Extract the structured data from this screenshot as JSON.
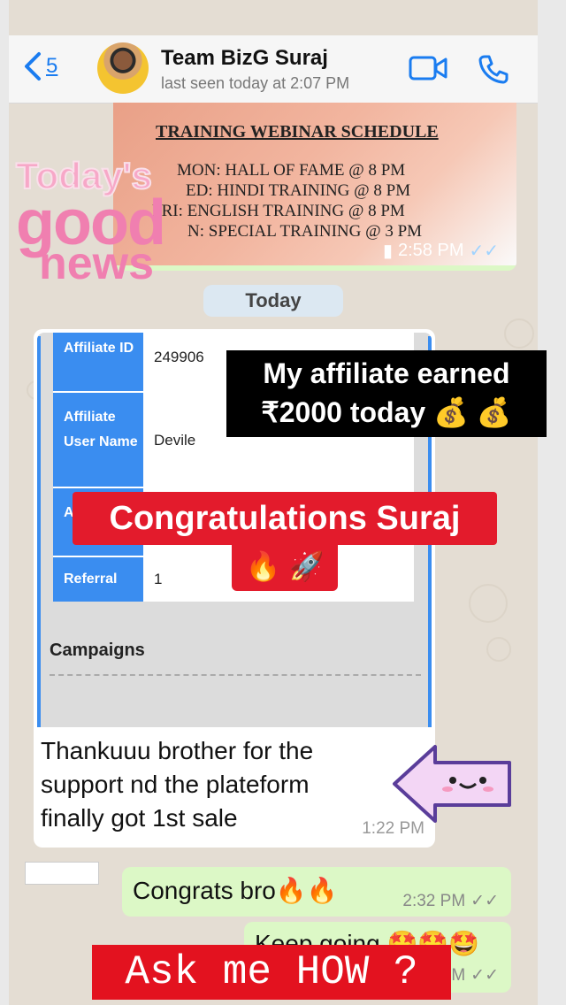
{
  "header": {
    "back_count": "5",
    "contact_name": "Team BizG Suraj",
    "last_seen": "last seen today at 2:07 PM"
  },
  "webinar_bubble": {
    "title": "TRAINING WEBINAR SCHEDULE",
    "lines": [
      "MON: HALL OF FAME @ 8 PM",
      "ED: HINDI TRAINING @ 8 PM",
      "FRI: ENGLISH TRAINING @ 8 PM",
      "N: SPECIAL TRAINING @ 3 PM"
    ],
    "time": "2:58 PM"
  },
  "sticker": {
    "line1": "Today's",
    "line2": "good",
    "line3": "news"
  },
  "date_divider": "Today",
  "incoming": {
    "table": [
      {
        "key": "Affiliate ID",
        "value": "249906"
      },
      {
        "key": "Affiliate User Name",
        "value": "Devile"
      },
      {
        "key": "A E",
        "value": ""
      },
      {
        "key": "Referral",
        "value": "1"
      }
    ],
    "campaigns_label": "Campaigns",
    "text": "Thankuuu brother for the support nd the plateform finally got 1st sale",
    "time": "1:22 PM"
  },
  "overlays": {
    "earned_line1": "My affiliate earned",
    "earned_line2": "₹2000 today 💰 💰",
    "congrats": "Congratulations Suraj",
    "fire_rocket": "🔥 🚀",
    "ask": "Ask me HOW ?"
  },
  "outgoing": [
    {
      "text": "Congrats bro🔥🔥",
      "time": "2:32 PM"
    },
    {
      "text": "Keep going 🤩🤩🤩",
      "time": "M"
    }
  ],
  "colors": {
    "accent_blue": "#1a7cf0",
    "bubble_green": "#dcf8c6",
    "overlay_red": "#e31b2c",
    "table_blue": "#3a8df0"
  }
}
